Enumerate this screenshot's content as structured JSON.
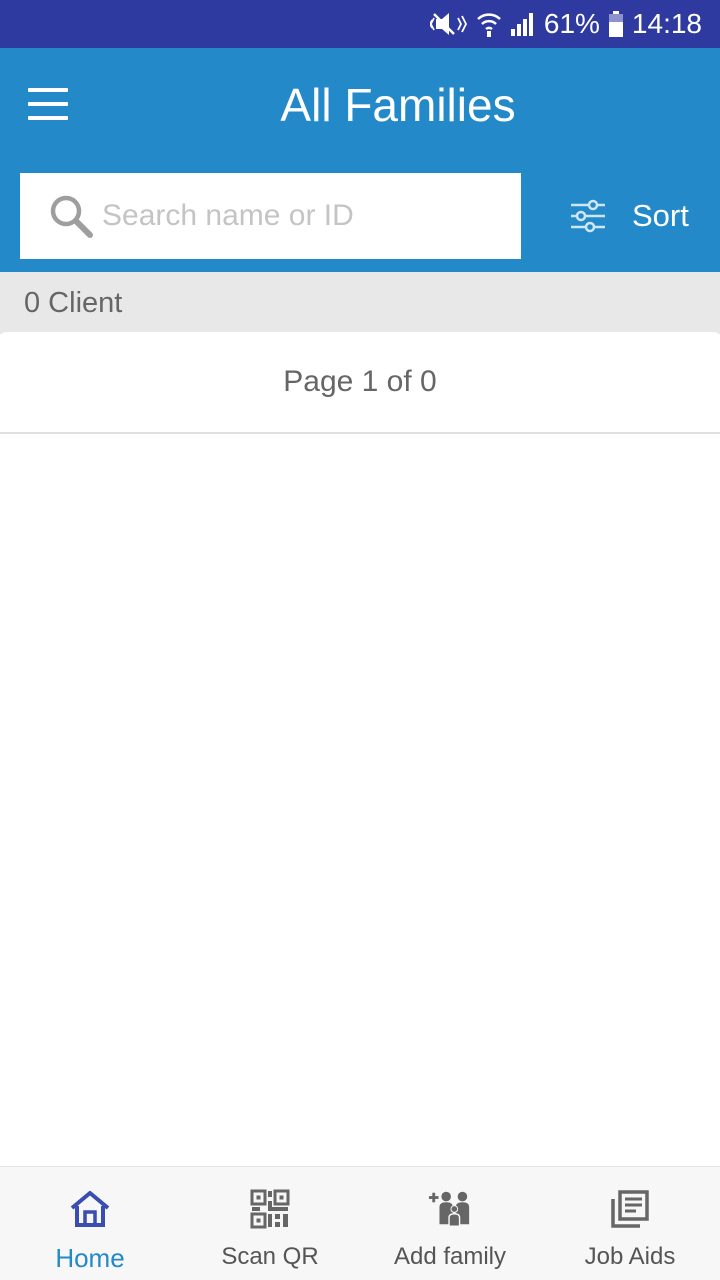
{
  "status_bar": {
    "battery_percent": "61%",
    "time": "14:18"
  },
  "app_bar": {
    "title": "All Families"
  },
  "search": {
    "placeholder": "Search name or ID",
    "value": ""
  },
  "sort": {
    "label": "Sort"
  },
  "client_count": {
    "label": "0 Client"
  },
  "pagination": {
    "label": "Page 1 of 0"
  },
  "bottom_nav": {
    "items": [
      {
        "label": "Home",
        "icon": "home-icon",
        "active": true
      },
      {
        "label": "Scan QR",
        "icon": "qr-code-icon",
        "active": false
      },
      {
        "label": "Add family",
        "icon": "add-family-icon",
        "active": false
      },
      {
        "label": "Job Aids",
        "icon": "library-books-icon",
        "active": false
      }
    ]
  },
  "colors": {
    "status_bar": "#2f3aa0",
    "app_bar": "#2389c9",
    "active_nav": "#2389c9",
    "active_icon": "#3a4db0",
    "inactive": "#555555"
  }
}
